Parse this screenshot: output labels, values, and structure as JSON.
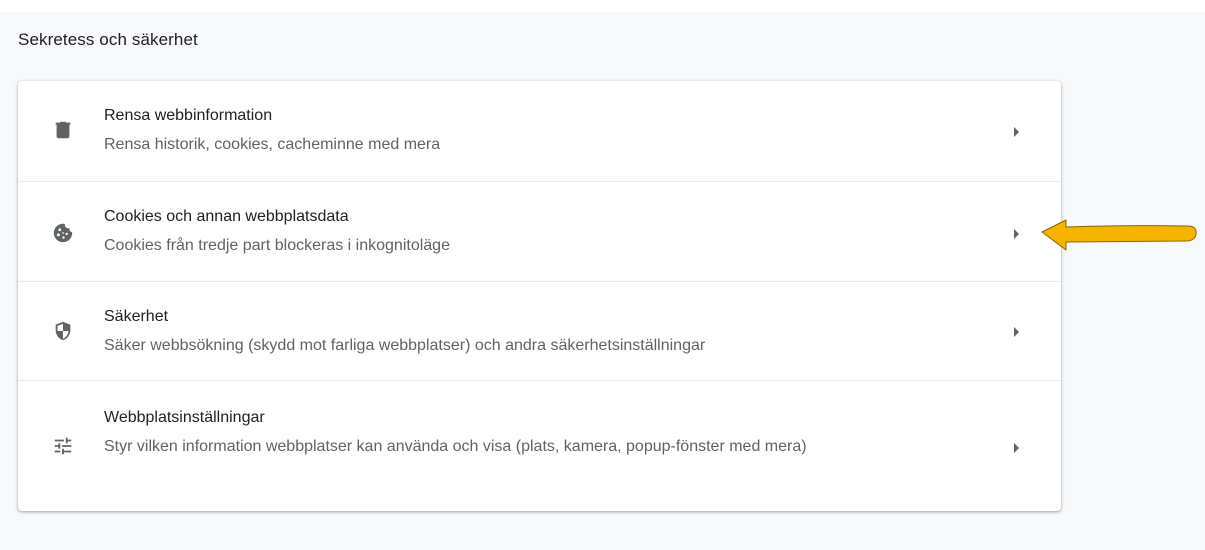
{
  "section": {
    "title": "Sekretess och säkerhet"
  },
  "rows": [
    {
      "title": "Rensa webbinformation",
      "subtitle": "Rensa historik, cookies, cacheminne med mera",
      "icon": "trash-icon"
    },
    {
      "title": "Cookies och annan webbplatsdata",
      "subtitle": "Cookies från tredje part blockeras i inkognitoläge",
      "icon": "cookie-icon"
    },
    {
      "title": "Säkerhet",
      "subtitle": "Säker webbsökning (skydd mot farliga webbplatser) och andra säkerhetsinställningar",
      "icon": "shield-icon"
    },
    {
      "title": "Webbplatsinställningar",
      "subtitle": "Styr vilken information webbplatser kan använda och visa (plats, kamera, popup-fönster med mera)",
      "icon": "tune-sliders-icon"
    }
  ],
  "colors": {
    "text_primary": "#202124",
    "text_secondary": "#5f6368",
    "icon": "#5f6368",
    "annotation_arrow": "#f5b400"
  }
}
